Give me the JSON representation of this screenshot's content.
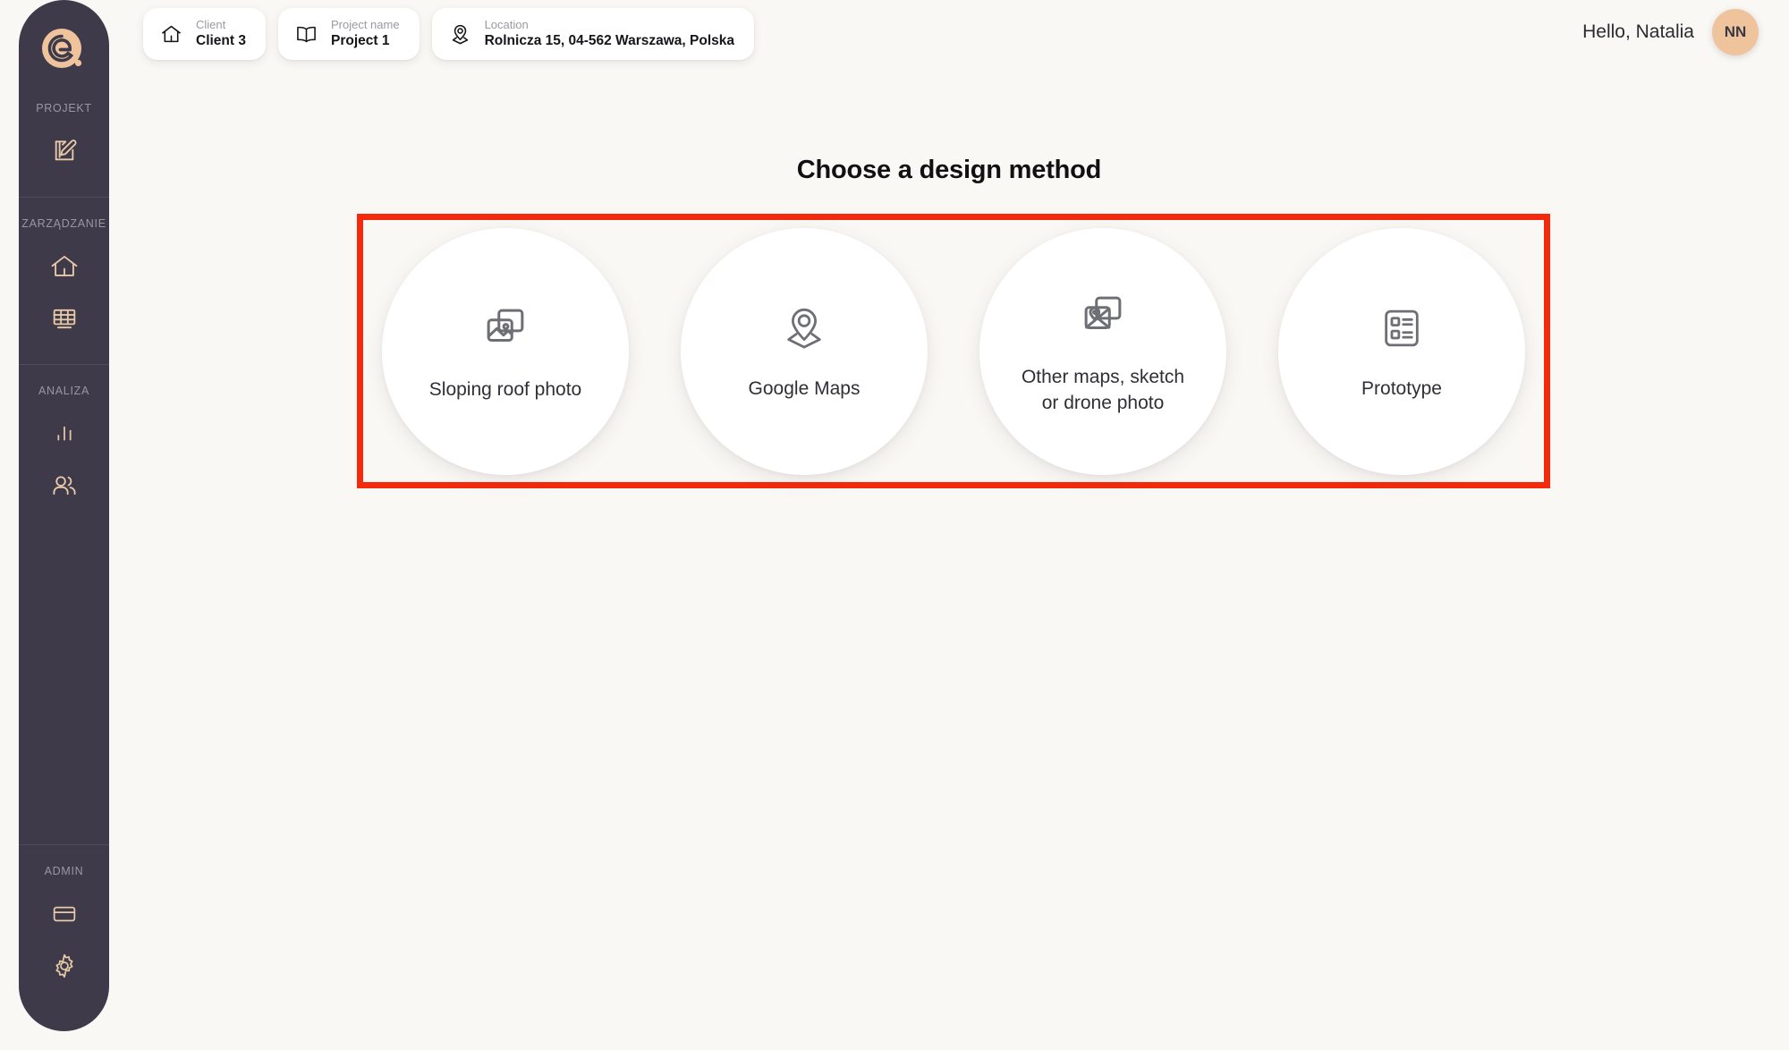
{
  "colors": {
    "background": "#faf8f4",
    "sidebar": "#3e3a4a",
    "accent_peach": "#efc49d",
    "highlight_red": "#f42a0c",
    "card_white": "#ffffff"
  },
  "sidebar": {
    "logo": "e-logo-icon",
    "sections": [
      {
        "label": "PROJEKT",
        "items": [
          {
            "name": "sidebar-item-projekt-edit",
            "icon": "edit-document-icon"
          }
        ]
      },
      {
        "label": "ZARZĄDZANIE",
        "items": [
          {
            "name": "sidebar-item-home",
            "icon": "home-icon"
          },
          {
            "name": "sidebar-item-solar-panel",
            "icon": "solar-panel-icon"
          }
        ]
      },
      {
        "label": "ANALIZA",
        "items": [
          {
            "name": "sidebar-item-statistics",
            "icon": "bar-chart-icon"
          },
          {
            "name": "sidebar-item-users",
            "icon": "users-icon"
          }
        ]
      },
      {
        "label": "ADMIN",
        "items": [
          {
            "name": "sidebar-item-billing",
            "icon": "credit-card-icon"
          },
          {
            "name": "sidebar-item-settings",
            "icon": "gear-icon"
          }
        ]
      }
    ]
  },
  "topbar": {
    "chips": [
      {
        "label": "Client",
        "value": "Client 3",
        "icon": "home-icon"
      },
      {
        "label": "Project name",
        "value": "Project 1",
        "icon": "open-book-icon"
      },
      {
        "label": "Location",
        "value": "Rolnicza 15, 04-562 Warszawa, Polska",
        "icon": "map-pin-icon"
      }
    ],
    "greeting": "Hello, Natalia",
    "avatar_initials": "NN"
  },
  "main": {
    "title": "Choose a design method",
    "methods": [
      {
        "label": "Sloping roof photo",
        "icon": "stacked-photos-icon"
      },
      {
        "label": "Google Maps",
        "icon": "map-pin-icon"
      },
      {
        "label": "Other maps, sketch or drone photo",
        "icon": "stacked-maps-icon"
      },
      {
        "label": "Prototype",
        "icon": "list-layout-icon"
      }
    ]
  }
}
